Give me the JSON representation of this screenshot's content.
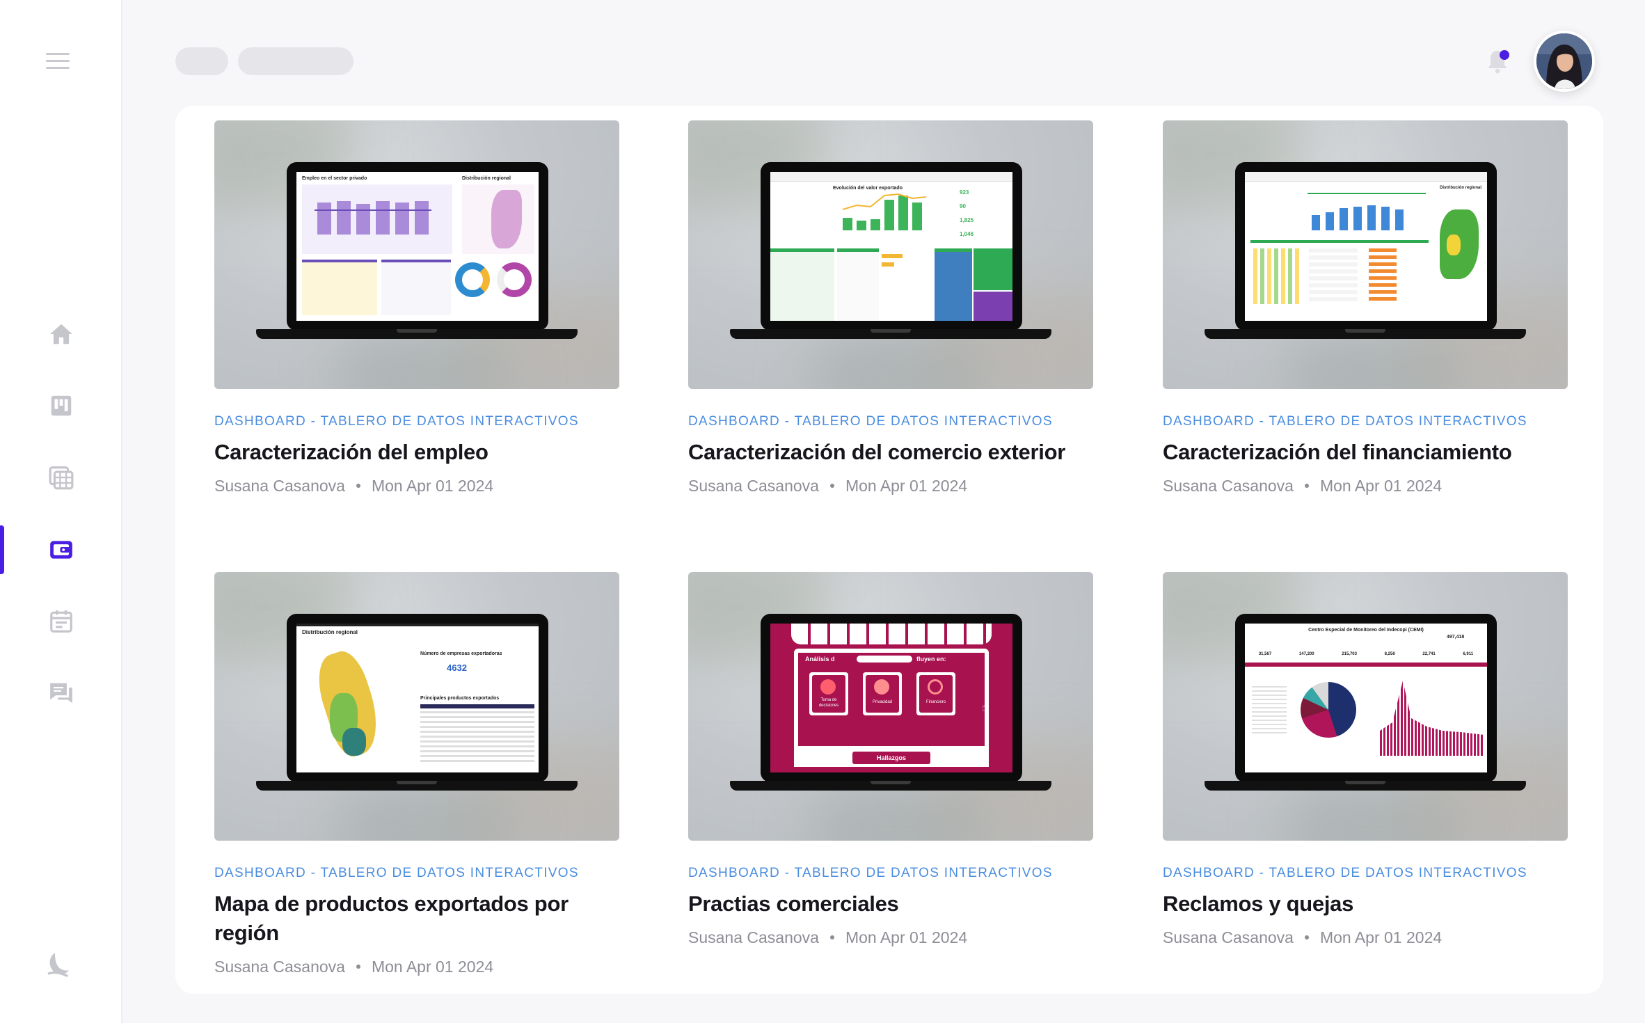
{
  "nav": {
    "items": [
      {
        "key": "home",
        "icon": "home-icon"
      },
      {
        "key": "board",
        "icon": "kanban-board-icon"
      },
      {
        "key": "calendar-grid",
        "icon": "calendar-grid-icon"
      },
      {
        "key": "wallet",
        "icon": "wallet-icon",
        "active": true
      },
      {
        "key": "schedule",
        "icon": "calendar-icon"
      },
      {
        "key": "messages",
        "icon": "chat-icon"
      }
    ],
    "theme_toggle_icon": "moon-icon",
    "accent_color": "#4b1ee3"
  },
  "topbar": {
    "bell_icon": "bell-icon",
    "avatar_icon": "user-avatar"
  },
  "cards": [
    {
      "category": "DASHBOARD - TABLERO DE DATOS INTERACTIVOS",
      "title": "Caracterización del empleo",
      "author": "Susana Casanova",
      "date": "Mon Apr 01 2024",
      "thumb_title": "Empleo en el sector privado",
      "thumb_subtitle": "Distribución regional"
    },
    {
      "category": "DASHBOARD - TABLERO DE DATOS INTERACTIVOS",
      "title": "Caracterización del comercio exterior",
      "author": "Susana Casanova",
      "date": "Mon Apr 01 2024",
      "thumb_title": "Evolución del valor exportado",
      "thumb_stats": [
        "923",
        "90",
        "1,825",
        "1,046"
      ]
    },
    {
      "category": "DASHBOARD - TABLERO DE DATOS INTERACTIVOS",
      "title": "Caracterización del financiamiento",
      "author": "Susana Casanova",
      "date": "Mon Apr 01 2024",
      "thumb_subtitle": "Distribución regional"
    },
    {
      "category": "DASHBOARD - TABLERO DE DATOS INTERACTIVOS",
      "title": "Mapa de productos exportados por región",
      "author": "Susana Casanova",
      "date": "Mon Apr 01 2024",
      "thumb_title": "Distribución regional",
      "thumb_subtitle": "Número de empresas exportadoras",
      "thumb_stat": "4632",
      "thumb_list_title": "Principales productos exportados"
    },
    {
      "category": "DASHBOARD - TABLERO DE DATOS INTERACTIVOS",
      "title": "Practias comerciales",
      "author": "Susana Casanova",
      "date": "Mon Apr 01 2024",
      "thumb_heading": "Análisis d",
      "thumb_heading_end": "fluyen en:",
      "thumb_labels": [
        "Toma de decisiones",
        "Privacidad",
        "Financiero"
      ],
      "thumb_footer": "Hallazgos"
    },
    {
      "category": "DASHBOARD - TABLERO DE DATOS INTERACTIVOS",
      "title": "Reclamos y quejas",
      "author": "Susana Casanova",
      "date": "Mon Apr 01 2024",
      "thumb_title": "Centro Especial de Monitoreo del Indecopi (CEMI)",
      "thumb_stats": [
        "497,418",
        "31,567",
        "147,200",
        "215,703",
        "8,256",
        "22,741",
        "6,911"
      ]
    }
  ]
}
